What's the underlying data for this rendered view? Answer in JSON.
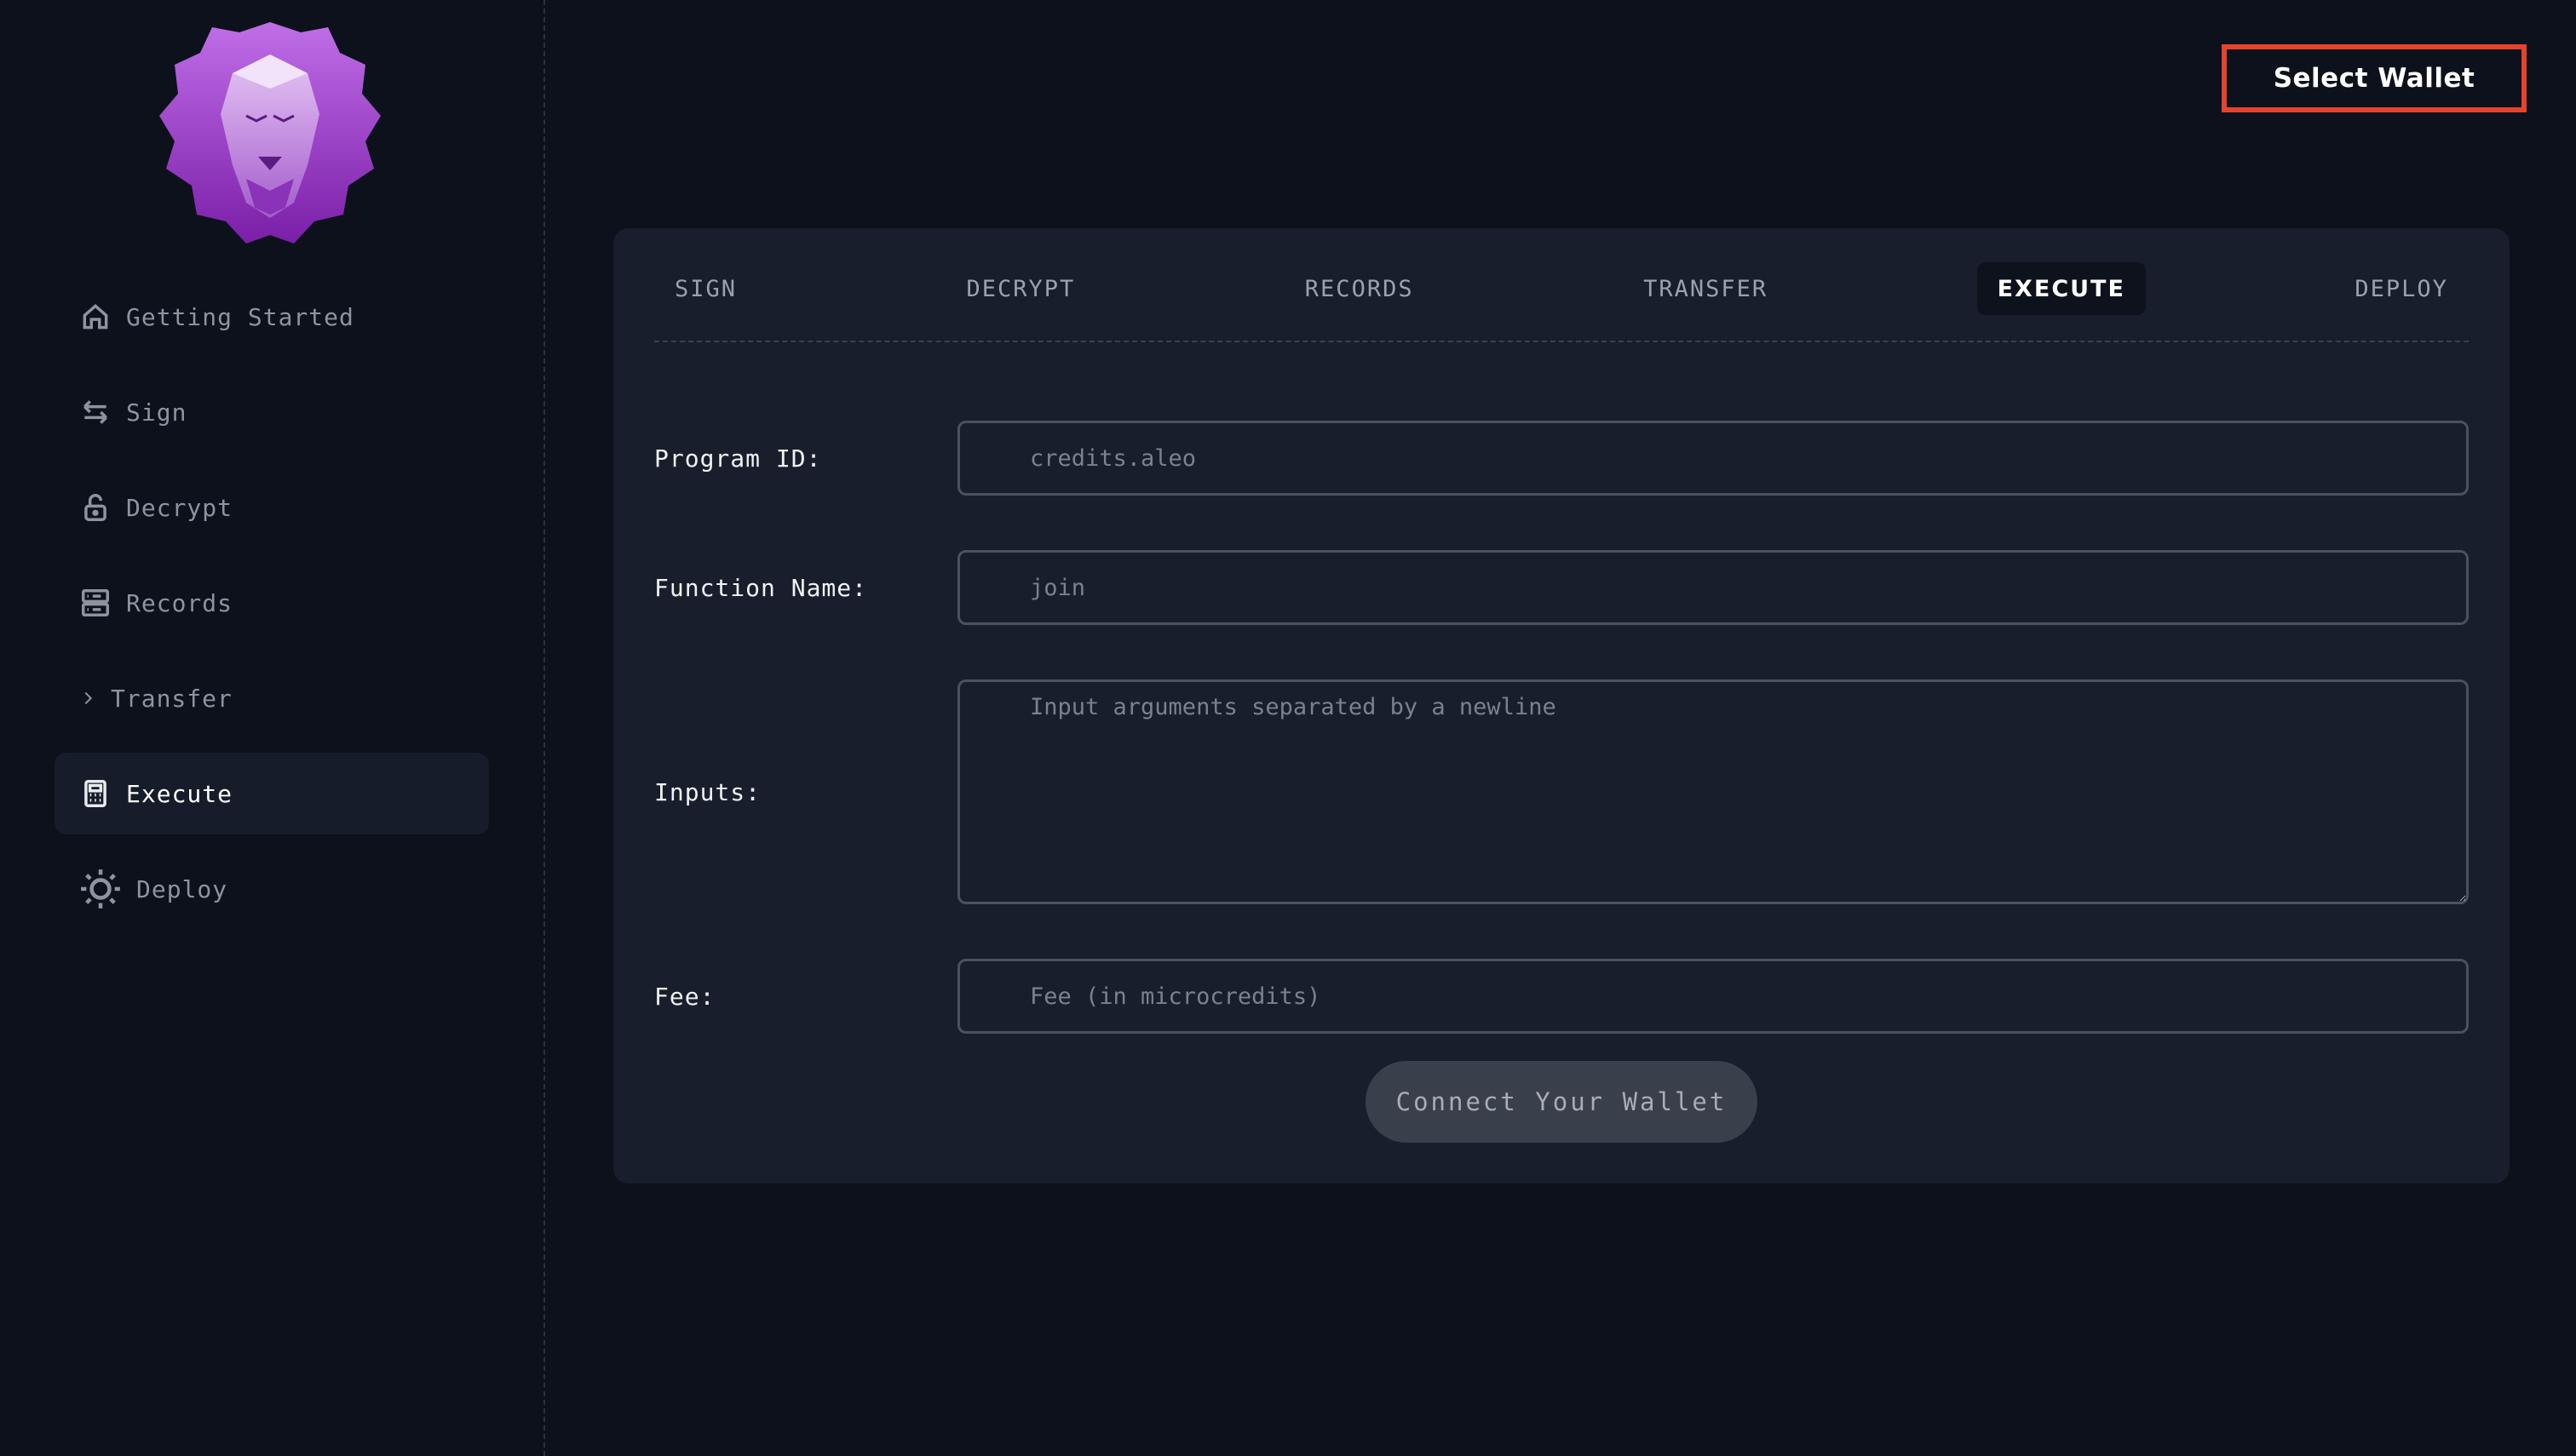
{
  "sidebar": {
    "items": [
      {
        "label": "Getting Started",
        "icon": "home-icon"
      },
      {
        "label": "Sign",
        "icon": "swap-arrows-icon"
      },
      {
        "label": "Decrypt",
        "icon": "unlock-icon"
      },
      {
        "label": "Records",
        "icon": "server-icon"
      },
      {
        "label": "Transfer",
        "icon": "chevron-right-icon"
      },
      {
        "label": "Execute",
        "icon": "calculator-icon"
      },
      {
        "label": "Deploy",
        "icon": "sun-icon"
      }
    ],
    "active_index": 5
  },
  "header": {
    "wallet_button_label": "Select Wallet"
  },
  "tabs": [
    {
      "label": "SIGN"
    },
    {
      "label": "DECRYPT"
    },
    {
      "label": "RECORDS"
    },
    {
      "label": "TRANSFER"
    },
    {
      "label": "EXECUTE"
    },
    {
      "label": "DEPLOY"
    }
  ],
  "active_tab": "EXECUTE",
  "form": {
    "program_id": {
      "label": "Program ID:",
      "placeholder": "credits.aleo"
    },
    "function_name": {
      "label": "Function Name:",
      "placeholder": "join"
    },
    "inputs": {
      "label": "Inputs:",
      "placeholder": "Input arguments separated by a newline"
    },
    "fee": {
      "label": "Fee:",
      "placeholder": "Fee (in microcredits)"
    },
    "submit_label": "Connect Your Wallet"
  },
  "colors": {
    "background": "#0c111b",
    "card": "#181e2c",
    "wallet_border": "#e5432d",
    "logo_purple": "#9b3fc8"
  }
}
